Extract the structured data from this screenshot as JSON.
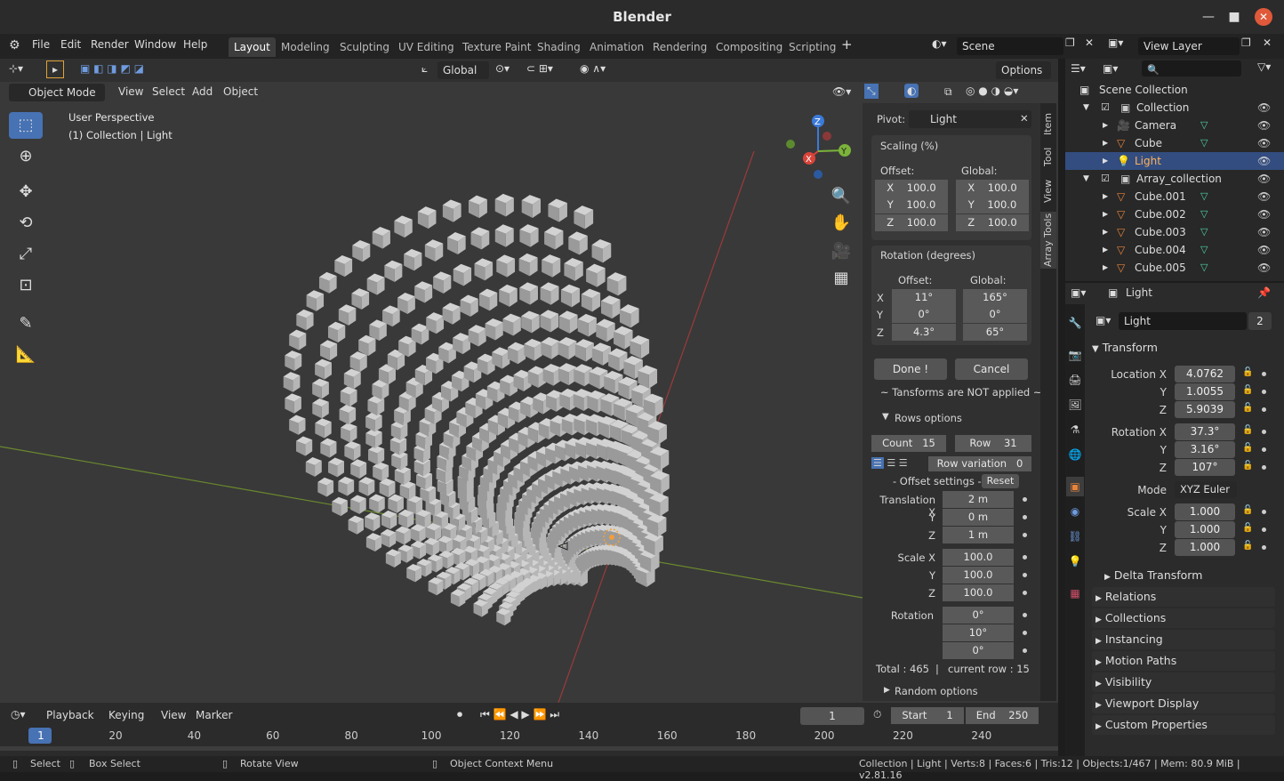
{
  "window": {
    "title": "Blender"
  },
  "menu": {
    "file": "File",
    "edit": "Edit",
    "render": "Render",
    "window": "Window",
    "help": "Help"
  },
  "workspaces": [
    "Layout",
    "Modeling",
    "Sculpting",
    "UV Editing",
    "Texture Paint",
    "Shading",
    "Animation",
    "Rendering",
    "Compositing",
    "Scripting"
  ],
  "scene": {
    "name": "Scene",
    "view_layer": "View Layer"
  },
  "viewport": {
    "orientation": "Global",
    "options": "Options",
    "mode": "Object Mode",
    "menus": [
      "View",
      "Select",
      "Add",
      "Object"
    ],
    "overlay_line1": "User Perspective",
    "overlay_line2": "(1) Collection | Light"
  },
  "gizmo": {
    "z": "Z",
    "x": "X",
    "y": "Y"
  },
  "array_panel": {
    "pivot_label": "Pivot:",
    "pivot_value": "Light",
    "scaling_title": "Scaling (%)",
    "offset_label": "Offset:",
    "global_label": "Global:",
    "scale_offset": {
      "x": "100.0",
      "y": "100.0",
      "z": "100.0"
    },
    "scale_global": {
      "x": "100.0",
      "y": "100.0",
      "z": "100.0"
    },
    "rotation_title": "Rotation (degrees)",
    "rot_offset": {
      "x": "11°",
      "y": "0°",
      "z": "4.3°"
    },
    "rot_global": {
      "x": "165°",
      "y": "0°",
      "z": "65°"
    },
    "done": "Done !",
    "cancel": "Cancel",
    "note": "~ Tansforms are NOT applied ~",
    "rows_title": "Rows options",
    "count_label": "Count",
    "count": "15",
    "row_label": "Row",
    "row": "31",
    "row_variation_label": "Row variation",
    "row_variation": "0",
    "offset_settings": "- Offset settings -",
    "reset": "Reset",
    "translation_label": "Translation X",
    "translation": {
      "x": "2 m",
      "y": "0 m",
      "z": "1 m"
    },
    "scale_label": "Scale X",
    "scale": {
      "x": "100.0",
      "y": "100.0",
      "z": "100.0"
    },
    "rotation_label": "Rotation",
    "rotation": {
      "x": "0°",
      "y": "10°",
      "z": "0°"
    },
    "total": "Total : 465",
    "current_row": "current row : 15",
    "random_title": "Random options"
  },
  "side_tabs": [
    "Item",
    "Tool",
    "View",
    "Array Tools"
  ],
  "axis_letters": {
    "x": "X",
    "y": "Y",
    "z": "Z"
  },
  "outliner": {
    "root": "Scene Collection",
    "items": [
      {
        "name": "Collection",
        "level": 1
      },
      {
        "name": "Camera",
        "level": 2
      },
      {
        "name": "Cube",
        "level": 2
      },
      {
        "name": "Light",
        "level": 2,
        "selected": true
      },
      {
        "name": "Array_collection",
        "level": 1
      },
      {
        "name": "Cube.001",
        "level": 2
      },
      {
        "name": "Cube.002",
        "level": 2
      },
      {
        "name": "Cube.003",
        "level": 2
      },
      {
        "name": "Cube.004",
        "level": 2
      },
      {
        "name": "Cube.005",
        "level": 2
      }
    ]
  },
  "properties": {
    "header_object": "Light",
    "object_name": "Light",
    "users": "2",
    "transform": "Transform",
    "location_label": "Location X",
    "location": {
      "x": "4.0762",
      "y": "1.0055",
      "z": "5.9039"
    },
    "rotation_label": "Rotation X",
    "rotation": {
      "x": "37.3°",
      "y": "3.16°",
      "z": "107°"
    },
    "mode_label": "Mode",
    "mode": "XYZ Euler",
    "scale_label": "Scale X",
    "scale": {
      "x": "1.000",
      "y": "1.000",
      "z": "1.000"
    },
    "y_label": "Y",
    "z_label": "Z",
    "delta": "Delta Transform",
    "panels": [
      "Relations",
      "Collections",
      "Instancing",
      "Motion Paths",
      "Visibility",
      "Viewport Display",
      "Custom Properties"
    ]
  },
  "timeline": {
    "menus": [
      "Playback",
      "Keying",
      "View",
      "Marker"
    ],
    "current_frame": "1",
    "start_label": "Start",
    "start": "1",
    "end_label": "End",
    "end": "250",
    "ticks": [
      "1",
      "20",
      "40",
      "60",
      "80",
      "100",
      "120",
      "140",
      "160",
      "180",
      "200",
      "220",
      "240"
    ]
  },
  "status": {
    "select": "Select",
    "box_select": "Box Select",
    "rotate_view": "Rotate View",
    "context_menu": "Object Context Menu",
    "info": "Collection | Light | Verts:8 | Faces:6 | Tris:12 | Objects:1/467 | Mem: 80.9 MiB | v2.81.16"
  },
  "colors": {
    "accent": "#4772b3",
    "selected_row": "#334d80",
    "close_button": "#e0593a"
  }
}
